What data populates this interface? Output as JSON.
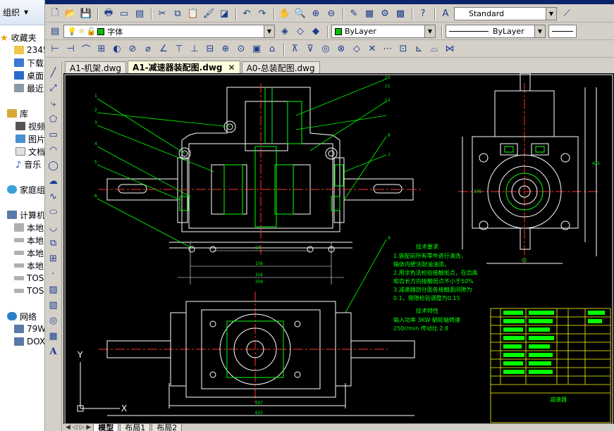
{
  "explorer": {
    "organize": "组织",
    "favorites": "收藏夹",
    "items": [
      {
        "label": "2345",
        "icon": "folder-icon"
      },
      {
        "label": "下载",
        "icon": "download-folder-icon"
      },
      {
        "label": "桌面",
        "icon": "desktop-icon"
      },
      {
        "label": "最近",
        "icon": "recent-icon"
      }
    ],
    "library": "库",
    "library_items": [
      {
        "label": "视频",
        "icon": "video-icon"
      },
      {
        "label": "图片",
        "icon": "picture-icon"
      },
      {
        "label": "文档",
        "icon": "document-icon"
      },
      {
        "label": "音乐",
        "icon": "music-icon"
      }
    ],
    "homegroup": "家庭组",
    "computer": "计算机",
    "drives": [
      "本地",
      "本地",
      "本地",
      "本地",
      "TOSH",
      "TOSH"
    ],
    "network": "网络",
    "network_items": [
      "79W",
      "DOXT"
    ]
  },
  "toolbar": {
    "text_style": "Standard",
    "layer": "字体",
    "color": "ByLayer",
    "linetype": "ByLayer"
  },
  "tabs": [
    {
      "label": "A1-机架.dwg",
      "active": false
    },
    {
      "label": "A1-减速器装配图.dwg",
      "active": true
    },
    {
      "label": "A0-总装配图.dwg",
      "active": false
    }
  ],
  "layout_tabs": [
    "模型",
    "布局1",
    "布局2"
  ],
  "drawing": {
    "tech_req_title": "技术要求",
    "tech_req_lines": [
      "1.装配前所有零件进行清洗，",
      "  箱体内壁涂耐油油漆。",
      "2.用涂色法检验接触斑点，在齿高",
      "  和齿长方向接触斑点不小于50%",
      "3.减速器剖分面各接触面间隙为",
      "  0.1，侧隙检验调整为0.15"
    ],
    "tech_char_title": "技术特性",
    "tech_char_lines": [
      "输入功率 3KW 蜗轮轴转速",
      "250r/min  传动比 2.8"
    ],
    "dims": [
      "87",
      "156",
      "316",
      "250",
      "297",
      "615",
      "375",
      "425",
      "95"
    ],
    "balloons": [
      "1",
      "2",
      "3",
      "4",
      "5",
      "6",
      "7",
      "8",
      "9",
      "10",
      "11",
      "12"
    ],
    "title_block_name": "减速器"
  },
  "colors": {
    "canvas": "#000000",
    "line_white": "#ffffff",
    "line_green": "#00ff00",
    "line_red": "#ff3030",
    "line_yellow": "#ffff00"
  }
}
